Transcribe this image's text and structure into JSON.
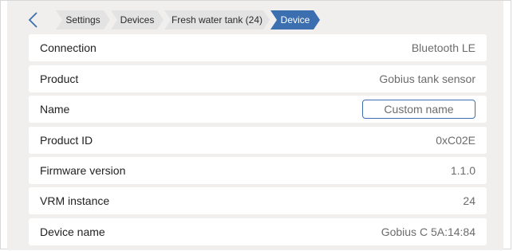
{
  "breadcrumb": {
    "items": [
      {
        "label": "Settings"
      },
      {
        "label": "Devices"
      },
      {
        "label": "Fresh water tank (24)"
      },
      {
        "label": "Device",
        "active": true
      }
    ],
    "active_color": "#3b6fb0",
    "inactive_color": "#e3e3e3"
  },
  "rows": [
    {
      "label": "Connection",
      "value": "Bluetooth LE"
    },
    {
      "label": "Product",
      "value": "Gobius tank sensor"
    },
    {
      "label": "Name",
      "placeholder": "Custom name"
    },
    {
      "label": "Product ID",
      "value": "0xC02E"
    },
    {
      "label": "Firmware version",
      "value": "1.1.0"
    },
    {
      "label": "VRM instance",
      "value": "24"
    },
    {
      "label": "Device name",
      "value": "Gobius C 5A:14:84"
    }
  ],
  "icons": {
    "back": "chevron-left-icon"
  }
}
